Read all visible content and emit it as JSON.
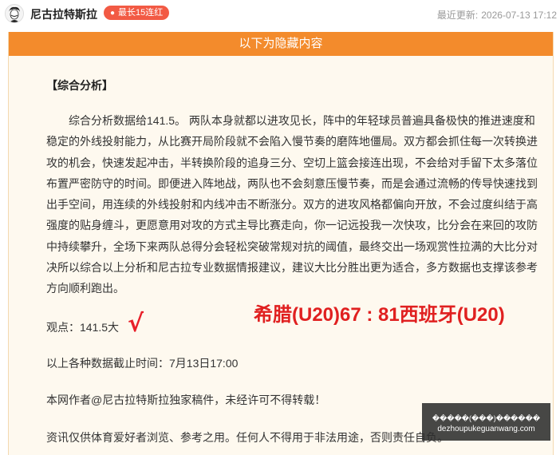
{
  "header": {
    "author_name": "尼古拉特斯拉",
    "streak_badge": "最长15连红",
    "updated_label": "最近更新:",
    "updated_time": "2026-07-13 17:12"
  },
  "hidden_content": {
    "banner": "以下为隐藏内容",
    "section_title": "【综合分析】",
    "analysis_text": "综合分析数据给141.5。 两队本身就都以进攻见长，阵中的年轻球员普遍具备极快的推进速度和稳定的外线投射能力，从比赛开局阶段就不会陷入慢节奏的磨阵地僵局。双方都会抓住每一次转换进攻的机会，快速发起冲击，半转换阶段的追身三分、空切上篮会接连出现，不会给对手留下太多落位布置严密防守的时间。即便进入阵地战，两队也不会刻意压慢节奏，而是会通过流畅的传导快速找到出手空间，用连续的外线投射和内线冲击不断涨分。双方的进攻风格都偏向开放，不会过度纠结于高强度的贴身缠斗，更愿意用对攻的方式主导比赛走向，你一记远投我一次快攻，比分会在来回的攻防中持续攀升，全场下来两队总得分会轻松突破常规对抗的阈值，最终交出一场观赏性拉满的大比分对决所以综合以上分析和尼古拉专业数据情报建议，建议大比分胜出更为适合，多方数据也支撑该参考方向顺利跑出。",
    "viewpoint": "观点：141.5大",
    "check": "√",
    "match_result": "希腊(U20)67 : 81西班牙(U20)",
    "deadline": "以上各种数据截止时间：7月13日17:00",
    "copyright": "本网作者@尼古拉特斯拉独家稿件，未经许可不得转载！",
    "disclaimer": "资讯仅供体育爱好者浏览、参考之用。任何人不得用于非法用途，否则责任自负。"
  },
  "watermark": {
    "title": "�����(���)������",
    "url": "dezhoupukeguanwang.com"
  }
}
